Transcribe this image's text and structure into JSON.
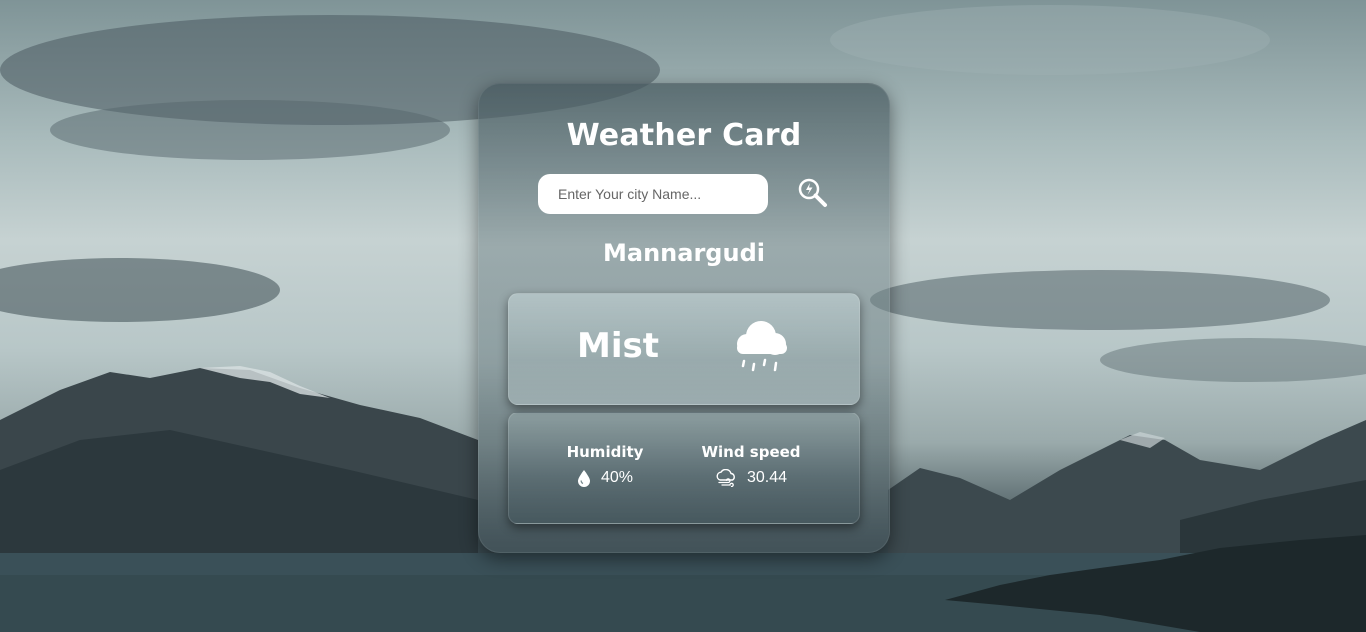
{
  "card": {
    "title": "Weather Card"
  },
  "search": {
    "placeholder": "Enter Your city Name...",
    "value": "",
    "button_icon": "search-icon"
  },
  "weather": {
    "city": "Mannargudi",
    "condition": "Mist",
    "condition_icon": "rain-cloud-icon"
  },
  "stats": {
    "humidity_label": "Humidity",
    "humidity_value": "40%",
    "humidity_icon": "water-drop-icon",
    "wind_label": "Wind speed",
    "wind_value": "30.44",
    "wind_icon": "wind-cloud-icon"
  },
  "colors": {
    "text": "#ffffff",
    "input_bg": "#ffffff"
  }
}
